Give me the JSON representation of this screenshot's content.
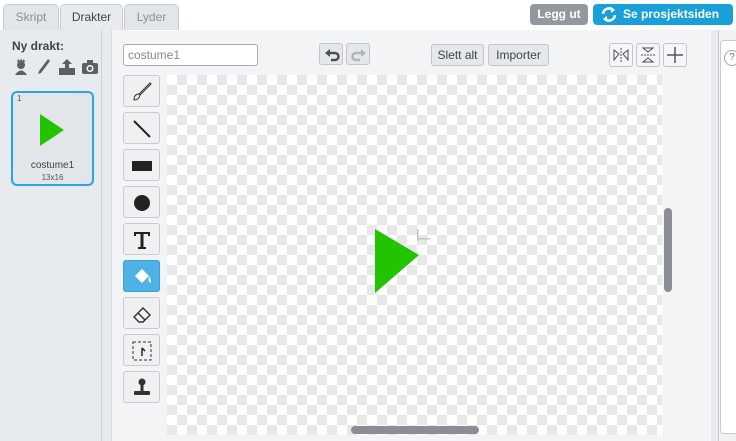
{
  "tabs": [
    {
      "label": "Skript",
      "active": false
    },
    {
      "label": "Drakter",
      "active": true
    },
    {
      "label": "Lyder",
      "active": false
    }
  ],
  "header": {
    "logout_label": "Legg ut",
    "project_label": "Se prosjektsiden"
  },
  "sidebar": {
    "new_costume_label": "Ny drakt:",
    "new_icons": [
      "sprite-library-icon",
      "paint-brush-icon",
      "upload-icon",
      "camera-icon"
    ],
    "costumes": [
      {
        "number": "1",
        "name": "costume1",
        "size": "13x16",
        "selected": true
      }
    ]
  },
  "editor": {
    "costume_name_value": "costume1",
    "clear_label": "Slett alt",
    "import_label": "Importer",
    "tools": [
      {
        "name": "brush-tool",
        "icon": "brush-icon",
        "active": false
      },
      {
        "name": "line-tool",
        "icon": "line-icon",
        "active": false
      },
      {
        "name": "rectangle-tool",
        "icon": "rectangle-icon",
        "active": false
      },
      {
        "name": "ellipse-tool",
        "icon": "ellipse-icon",
        "active": false
      },
      {
        "name": "text-tool",
        "icon": "text-icon",
        "active": false
      },
      {
        "name": "fill-tool",
        "icon": "paint-bucket-icon",
        "active": true
      },
      {
        "name": "eraser-tool",
        "icon": "eraser-icon",
        "active": false
      },
      {
        "name": "select-tool",
        "icon": "select-icon",
        "active": false
      },
      {
        "name": "stamp-tool",
        "icon": "stamp-icon",
        "active": false
      }
    ]
  },
  "colors": {
    "accent": "#1aa0d8",
    "selected_border": "#29a6dd",
    "active_tool": "#4eb2e6",
    "sprite": "#22c400",
    "logout": "#93989f"
  }
}
